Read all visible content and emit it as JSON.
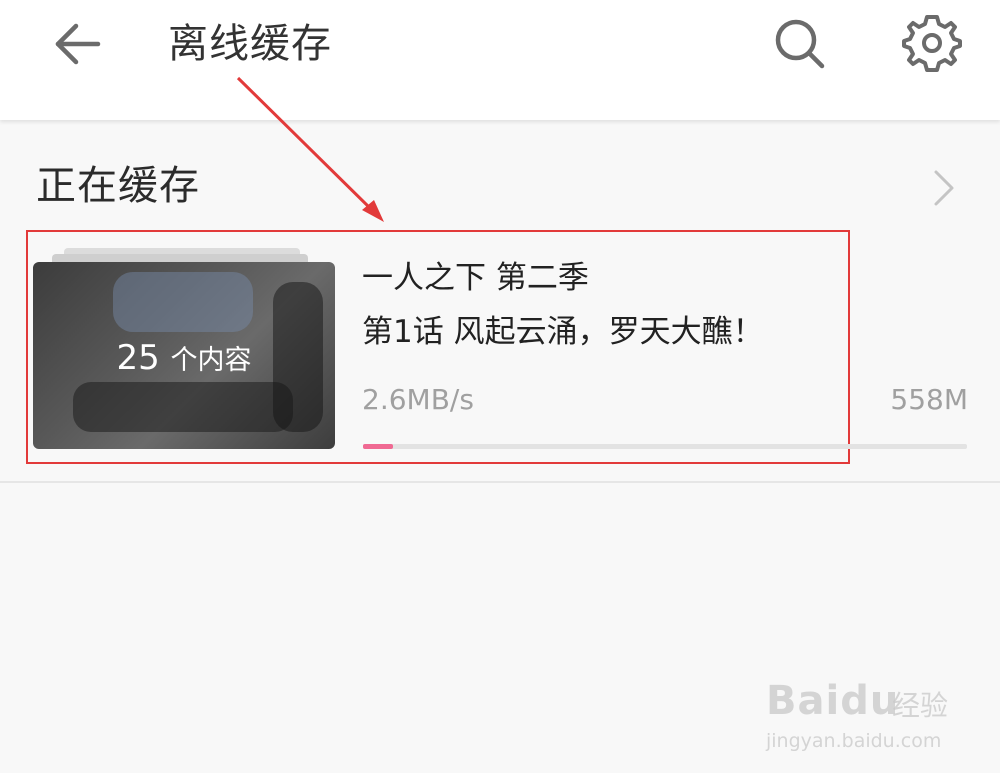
{
  "header": {
    "title": "离线缓存",
    "back_icon": "arrow-left-icon",
    "search_icon": "search-icon",
    "settings_icon": "gear-icon"
  },
  "section": {
    "title": "正在缓存",
    "chevron_icon": "chevron-right-icon"
  },
  "download_item": {
    "count_number": "25",
    "count_unit": "个内容",
    "series_title": "一人之下 第二季",
    "episode_title": "第1话 风起云涌，罗天大醮！",
    "speed": "2.6MB/s",
    "size": "558M",
    "progress_fraction": 0.05
  },
  "colors": {
    "progress": "#f06a93",
    "annotation": "#e23a3a"
  },
  "watermark": {
    "logo": "Baidu",
    "label": "经验",
    "url": "jingyan.baidu.com"
  }
}
